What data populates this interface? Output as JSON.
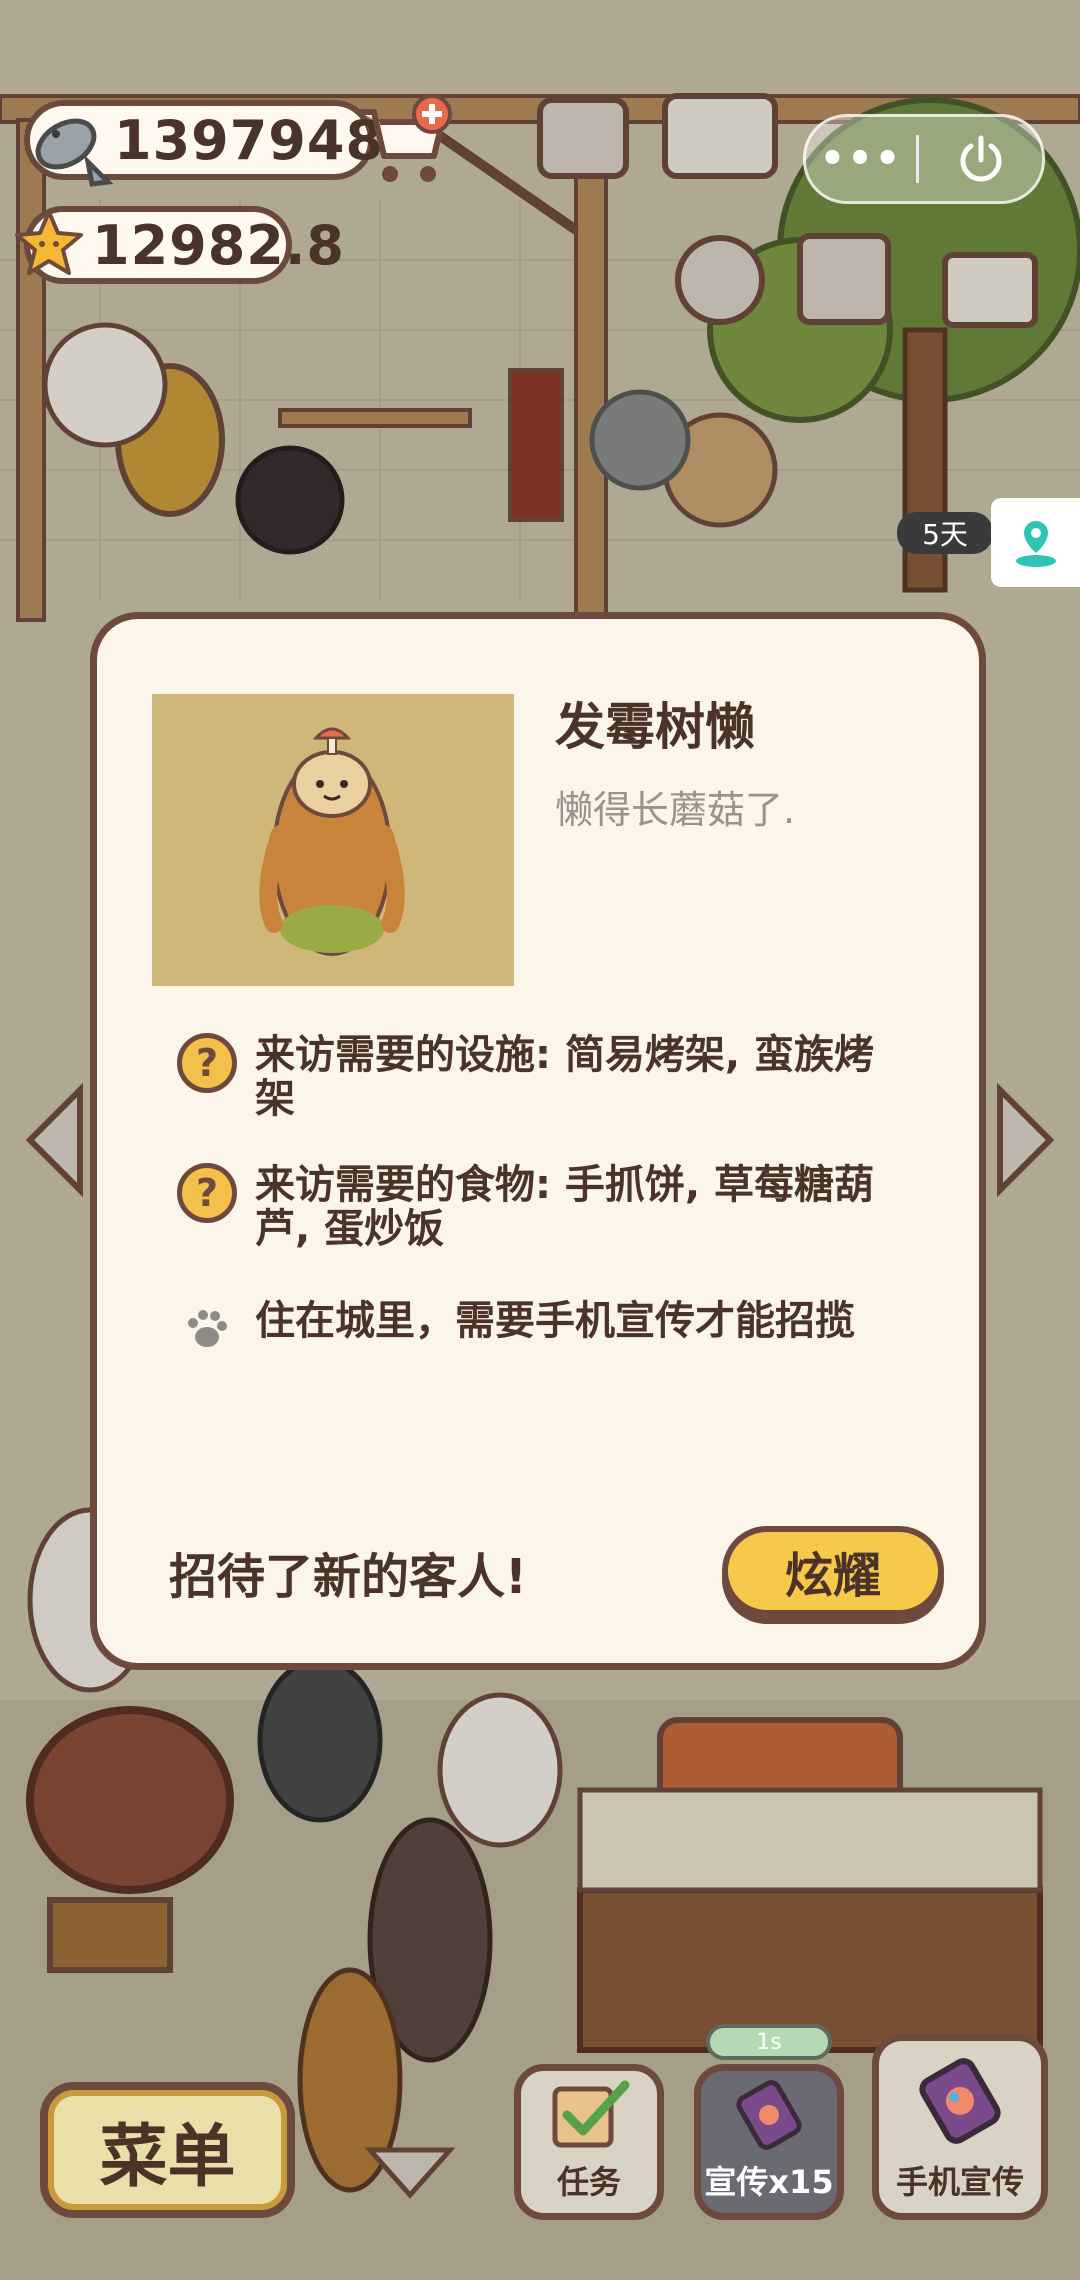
{
  "hud": {
    "fish_count": "1397948",
    "star_count": "12982.8",
    "more_label": "•••",
    "days_badge": "5天"
  },
  "dialog": {
    "title": "发霉树懒",
    "subtitle": "懒得长蘑菇了.",
    "requirements": [
      {
        "icon": "question-icon",
        "text": "来访需要的设施: 简易烤架, 蛮族烤架"
      },
      {
        "icon": "question-icon",
        "text": "来访需要的食物: 手抓饼, 草莓糖葫芦, 蛋炒饭"
      },
      {
        "icon": "paw-icon",
        "text": "住在城里，需要手机宣传才能招揽"
      }
    ],
    "footer_text": "招待了新的客人!",
    "show_button": "炫耀"
  },
  "bottom_bar": {
    "menu_label": "菜单",
    "tasks_label": "任务",
    "promo_x15_label": "宣传x15",
    "phone_promo_label": "手机宣传",
    "timer_label": "1s"
  },
  "colors": {
    "outline": "#6e4a3e",
    "dialog_bg": "#fcf5ea",
    "accent_yellow": "#f7c94a",
    "text_dark": "#4b3328"
  }
}
